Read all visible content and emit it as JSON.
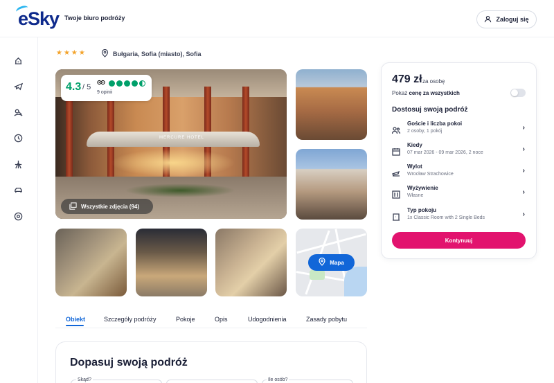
{
  "header": {
    "logo_text": "eSky",
    "tagline": "Twoje biuro podróży",
    "login_label": "Zaloguj się"
  },
  "sidebar": {
    "icons": [
      "hotel-flight-icon",
      "flight-icon",
      "vacation-icon",
      "last-minute-icon",
      "tour-icon",
      "car-icon",
      "help-icon"
    ]
  },
  "hotel": {
    "stars": "★★★★",
    "location": "Bułgaria, Sofia (miasto), Sofia",
    "rating_score": "4.3",
    "rating_of": "/ 5",
    "rating_count": "9 opinii",
    "all_photos_label": "Wszystkie zdjęcia (94)",
    "main_photo_caption": "MERCURE HOTEL",
    "map_label": "Mapa"
  },
  "tabs": [
    {
      "label": "Obiekt",
      "active": true
    },
    {
      "label": "Szczegóły podróży",
      "active": false
    },
    {
      "label": "Pokoje",
      "active": false
    },
    {
      "label": "Opis",
      "active": false
    },
    {
      "label": "Udogodnienia",
      "active": false
    },
    {
      "label": "Zasady pobytu",
      "active": false
    }
  ],
  "adjust": {
    "title": "Dopasuj swoją podróż",
    "field1_label": "Skąd?",
    "field3_label": "Ile osób?"
  },
  "booking": {
    "price": "479 zł",
    "price_suffix": "za osobę",
    "show_total_prefix": "Pokaż ",
    "show_total_bold": "cenę za wszystkich",
    "customize_title": "Dostosuj swoją podróż",
    "options": [
      {
        "icon": "guests-icon",
        "title": "Goście i liczba pokoi",
        "sub": "2 osoby, 1 pokój"
      },
      {
        "icon": "calendar-icon",
        "title": "Kiedy",
        "sub": "07 mar 2026 - 09 mar 2026, 2 noce"
      },
      {
        "icon": "departure-icon",
        "title": "Wylot",
        "sub": "Wrocław Strachowice"
      },
      {
        "icon": "meal-icon",
        "title": "Wyżywienie",
        "sub": "Własne"
      },
      {
        "icon": "room-icon",
        "title": "Typ pokoju",
        "sub": "1x Classic Room with 2 Single Beds"
      }
    ],
    "continue_label": "Kontynuuj"
  },
  "colors": {
    "brand_blue": "#0e2a8c",
    "accent_blue": "#1166d8",
    "cta_pink": "#e2136e",
    "rating_green": "#00a06a",
    "star_orange": "#f3a32b"
  }
}
